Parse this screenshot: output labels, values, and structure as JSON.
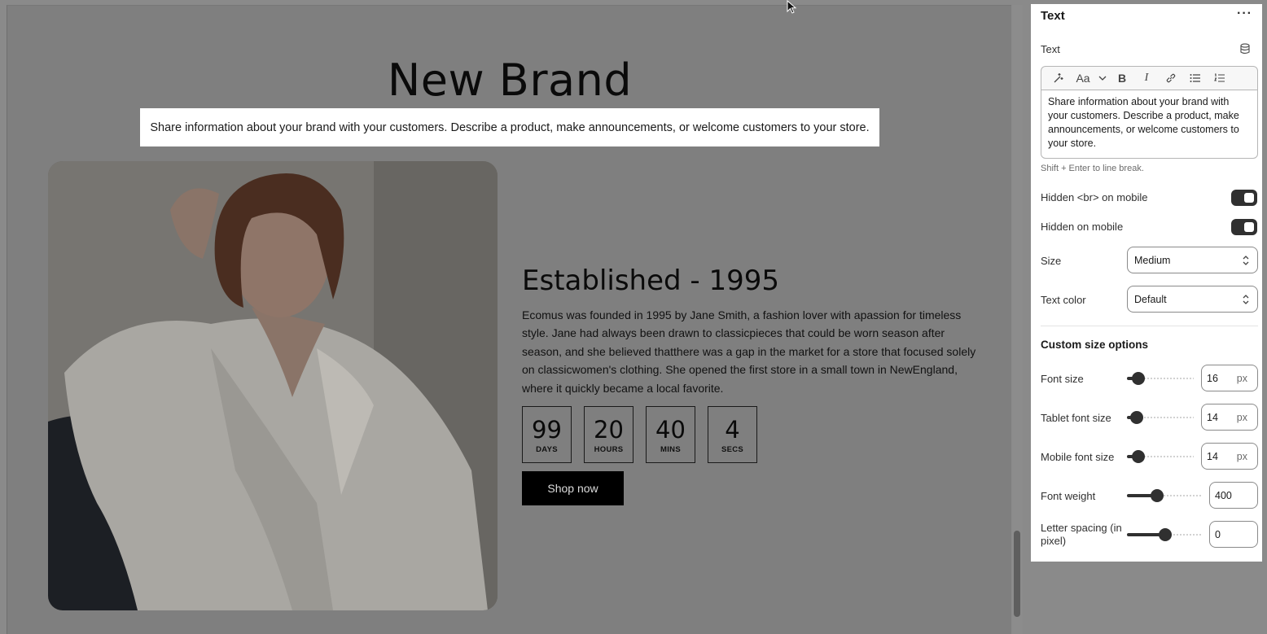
{
  "preview": {
    "brand_title": "New Brand",
    "intro_text": "Share information about your brand with your customers. Describe a product, make announcements, or welcome customers to your store.",
    "established_title": "Established - 1995",
    "established_body": "Ecomus was founded in 1995 by Jane Smith, a fashion lover with apassion for timeless style. Jane had always been drawn to classicpieces that could be worn season after season, and she believed thatthere was a gap in the market for a store that focused solely on classicwomen's clothing. She opened the first store in a small town in NewEngland, where it quickly became a local favorite.",
    "countdown": [
      {
        "value": "99",
        "unit": "DAYS"
      },
      {
        "value": "20",
        "unit": "HOURS"
      },
      {
        "value": "40",
        "unit": "MINS"
      },
      {
        "value": "4",
        "unit": "SECS"
      }
    ],
    "shop_button": "Shop now"
  },
  "panel": {
    "header": "Text",
    "more_icon": "···",
    "text_label": "Text",
    "toolbar_icons": [
      "magic-icon",
      "font-size-icon",
      "chevron-down-icon",
      "bold-icon",
      "italic-icon",
      "link-icon",
      "bullet-list-icon",
      "numbered-list-icon"
    ],
    "font_glyph": "Aa",
    "bold_glyph": "B",
    "italic_glyph": "I",
    "editor_text": "Share information about your brand with your customers. Describe a product, make announcements, or welcome customers to your store.",
    "hint": "Shift + Enter to line break.",
    "hidden_br_label": "Hidden <br> on mobile",
    "hidden_br_on": true,
    "hidden_mobile_label": "Hidden on mobile",
    "hidden_mobile_on": true,
    "size_label": "Size",
    "size_value": "Medium",
    "text_color_label": "Text color",
    "text_color_value": "Default",
    "custom_title": "Custom size options",
    "font_size_label": "Font size",
    "font_size_value": "16",
    "tablet_font_size_label": "Tablet font size",
    "tablet_font_size_value": "14",
    "mobile_font_size_label": "Mobile font size",
    "mobile_font_size_value": "14",
    "px_unit": "px",
    "font_weight_label": "Font weight",
    "font_weight_value": "400",
    "letter_spacing_label": "Letter spacing (in pixel)",
    "letter_spacing_value": "0"
  },
  "colors": {
    "overlay": "#7f7f7f",
    "button": "#000000",
    "toggle_on": "#303030"
  }
}
